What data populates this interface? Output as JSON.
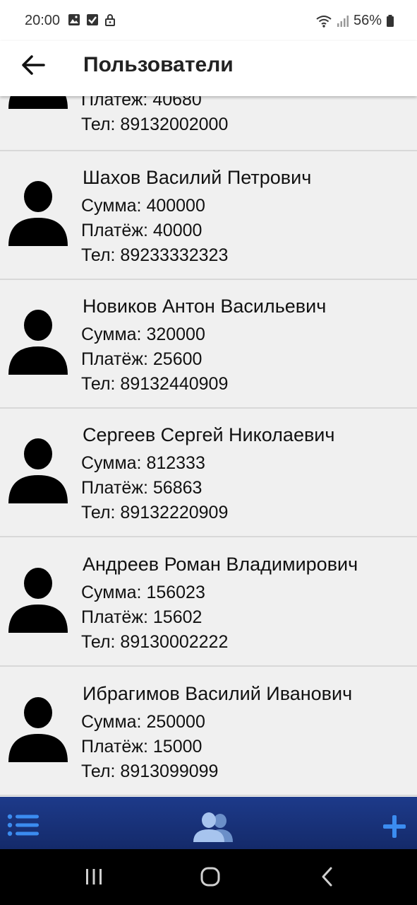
{
  "status_bar": {
    "time": "20:00",
    "battery": "56%"
  },
  "header": {
    "title": "Пользователи"
  },
  "partial_item": {
    "payment": "Платеж: 40680",
    "phone": "Тел: 89132002000"
  },
  "users": [
    {
      "name": "Шахов Василий Петрович",
      "sum": "Сумма: 400000",
      "payment": "Платёж: 40000",
      "phone": "Тел: 89233332323"
    },
    {
      "name": "Новиков Антон Васильевич",
      "sum": "Сумма: 320000",
      "payment": "Платёж: 25600",
      "phone": "Тел: 89132440909"
    },
    {
      "name": "Сергеев Сергей Николаевич",
      "sum": "Сумма: 812333",
      "payment": "Платёж: 56863",
      "phone": "Тел: 89132220909"
    },
    {
      "name": "Андреев Роман Владимирович",
      "sum": "Сумма: 156023",
      "payment": "Платёж: 15602",
      "phone": "Тел: 89130002222"
    },
    {
      "name": "Ибрагимов Василий Иванович",
      "sum": "Сумма: 250000",
      "payment": "Платёж: 15000",
      "phone": "Тел: 8913099099"
    }
  ],
  "bottom_nav": {
    "icons": [
      "list-icon",
      "users-icon",
      "add-icon"
    ],
    "accent": "#3b8cf0",
    "bar_color": "#1d3a8a"
  }
}
